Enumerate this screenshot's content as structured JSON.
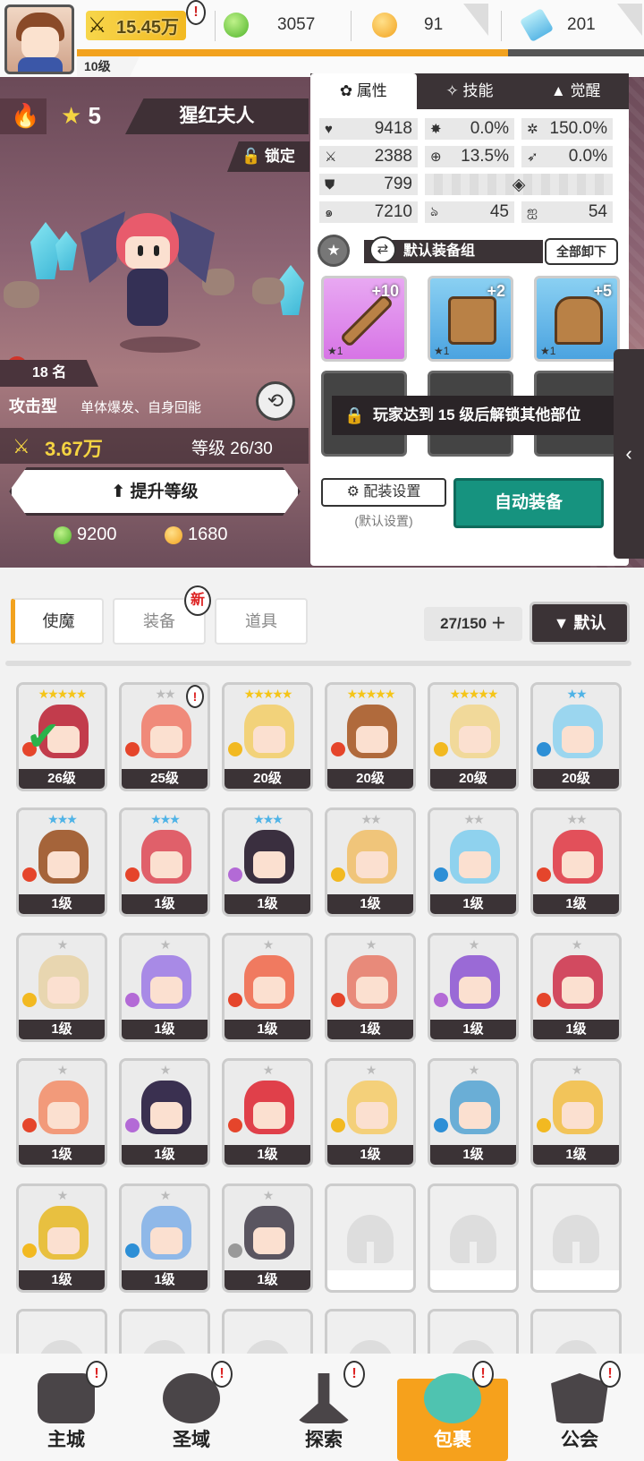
{
  "topbar": {
    "player_level": "10级",
    "power": "15.45万",
    "green_gems": "3057",
    "gold": "91",
    "crystals": "201",
    "alert": "!",
    "level_progress": 0.76
  },
  "hero": {
    "stars": "5",
    "name": "猩红夫人",
    "lock_label": "锁定",
    "heat_badge": "热",
    "heat_rank": "18 名",
    "type": "攻击型",
    "description": "单体爆发、自身回能",
    "power": "3.67万",
    "level_text": "等级 26/30",
    "upgrade_label": "提升等级",
    "cost_green": "9200",
    "cost_gold": "1680"
  },
  "panel": {
    "tabs": [
      "属性",
      "技能",
      "觉醒"
    ],
    "stats": {
      "hp": "9418",
      "crit": "0.0%",
      "crit_dmg": "150.0%",
      "atk": "2388",
      "hit": "13.5%",
      "dodge": "0.0%",
      "def": "799",
      "speed": "7210",
      "energy": "45",
      "regen": "54"
    },
    "equip_group": "默认装备组",
    "unequip_all": "全部卸下",
    "slots": [
      {
        "plus": "+10",
        "stars": "★1",
        "rarity": "purple",
        "item": "sword"
      },
      {
        "plus": "+2",
        "stars": "★1",
        "rarity": "blue",
        "item": "helmet"
      },
      {
        "plus": "+5",
        "stars": "★1",
        "rarity": "blue",
        "item": "armor"
      }
    ],
    "lock_msg": "玩家达到 15 级后解锁其他部位",
    "config_label": "配装设置",
    "config_sub": "(默认设置)",
    "auto_equip": "自动装备"
  },
  "inventory": {
    "tabs": [
      "使魔",
      "装备",
      "道具"
    ],
    "new_badge": "新",
    "count": "27/150",
    "sort_label": "▼ 默认",
    "cards": [
      {
        "stars": "★★★★★",
        "star_color": "#f5c518",
        "level": "26级",
        "color": "#c23c4c",
        "elem": "#e5452b",
        "check": true
      },
      {
        "stars": "★★",
        "star_color": "#bbb",
        "level": "25级",
        "color": "#f08a7a",
        "elem": "#e5452b",
        "alert": true
      },
      {
        "stars": "★★★★★",
        "star_color": "#f5c518",
        "level": "20级",
        "color": "#f2d27a",
        "elem": "#f2b921"
      },
      {
        "stars": "★★★★★",
        "star_color": "#f5c518",
        "level": "20级",
        "color": "#b06a3c",
        "elem": "#e5452b"
      },
      {
        "stars": "★★★★★",
        "star_color": "#f5c518",
        "level": "20级",
        "color": "#f1d99a",
        "elem": "#f2b921"
      },
      {
        "stars": "★★",
        "star_color": "#4fb3e6",
        "level": "20级",
        "color": "#9bd6ef",
        "elem": "#2d8fd6"
      },
      {
        "stars": "★★★",
        "star_color": "#4fb3e6",
        "level": "1级",
        "color": "#a5643a",
        "elem": "#e5452b"
      },
      {
        "stars": "★★★",
        "star_color": "#4fb3e6",
        "level": "1级",
        "color": "#e0606a",
        "elem": "#e5452b"
      },
      {
        "stars": "★★★",
        "star_color": "#4fb3e6",
        "level": "1级",
        "color": "#3a2f3f",
        "elem": "#b36ad6"
      },
      {
        "stars": "★★",
        "star_color": "#bbb",
        "level": "1级",
        "color": "#f0c57a",
        "elem": "#f2b921"
      },
      {
        "stars": "★★",
        "star_color": "#bbb",
        "level": "1级",
        "color": "#8fd2ee",
        "elem": "#2d8fd6"
      },
      {
        "stars": "★★",
        "star_color": "#bbb",
        "level": "1级",
        "color": "#e2505a",
        "elem": "#e5452b"
      },
      {
        "stars": "★",
        "star_color": "#bbb",
        "level": "1级",
        "color": "#e8d6b0",
        "elem": "#f2b921"
      },
      {
        "stars": "★",
        "star_color": "#bbb",
        "level": "1级",
        "color": "#a88ae6",
        "elem": "#b36ad6"
      },
      {
        "stars": "★",
        "star_color": "#bbb",
        "level": "1级",
        "color": "#f07a60",
        "elem": "#e5452b"
      },
      {
        "stars": "★",
        "star_color": "#bbb",
        "level": "1级",
        "color": "#e88a7a",
        "elem": "#e5452b"
      },
      {
        "stars": "★",
        "star_color": "#bbb",
        "level": "1级",
        "color": "#9a6ad6",
        "elem": "#b36ad6"
      },
      {
        "stars": "★",
        "star_color": "#bbb",
        "level": "1级",
        "color": "#d24a60",
        "elem": "#e5452b"
      },
      {
        "stars": "★",
        "star_color": "#bbb",
        "level": "1级",
        "color": "#f29a7a",
        "elem": "#e5452b"
      },
      {
        "stars": "★",
        "star_color": "#bbb",
        "level": "1级",
        "color": "#3a3050",
        "elem": "#b36ad6"
      },
      {
        "stars": "★",
        "star_color": "#bbb",
        "level": "1级",
        "color": "#e0404a",
        "elem": "#e5452b"
      },
      {
        "stars": "★",
        "star_color": "#bbb",
        "level": "1级",
        "color": "#f4d07a",
        "elem": "#f2b921"
      },
      {
        "stars": "★",
        "star_color": "#bbb",
        "level": "1级",
        "color": "#6aaed6",
        "elem": "#2d8fd6"
      },
      {
        "stars": "★",
        "star_color": "#bbb",
        "level": "1级",
        "color": "#f2c45a",
        "elem": "#f2b921"
      },
      {
        "stars": "★",
        "star_color": "#bbb",
        "level": "1级",
        "color": "#e8c040",
        "elem": "#f2b921"
      },
      {
        "stars": "★",
        "star_color": "#bbb",
        "level": "1级",
        "color": "#8fb8e8",
        "elem": "#2d8fd6"
      },
      {
        "stars": "★",
        "star_color": "#bbb",
        "level": "1级",
        "color": "#5a5560",
        "elem": "#999"
      }
    ]
  },
  "bottom_nav": [
    {
      "label": "主城"
    },
    {
      "label": "圣域"
    },
    {
      "label": "探索"
    },
    {
      "label": "包裹",
      "active": true
    },
    {
      "label": "公会"
    }
  ]
}
